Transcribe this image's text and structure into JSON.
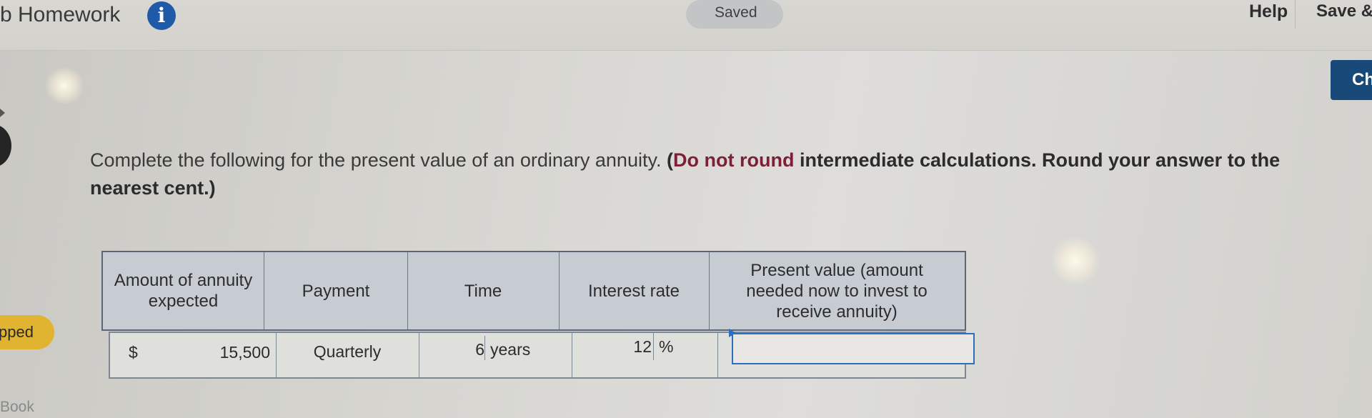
{
  "header": {
    "title": "b Homework",
    "info_glyph": "i",
    "saved_label": "Saved",
    "help_label": "Help",
    "save_exit_label": "Save &"
  },
  "check_button_label": "Ch",
  "sidebar": {
    "dropped_label": "pped",
    "ebook_label": "Book"
  },
  "question": {
    "text": "Complete the following for the present value of an ordinary annuity.",
    "instruction_open": "(",
    "instruction_do_not_round": "Do not round",
    "instruction_rest": "intermediate calculations. Round your answer to the nearest cent.)"
  },
  "table": {
    "headers": [
      "Amount of annuity expected",
      "Payment",
      "Time",
      "Interest rate",
      "Present value (amount needed now to invest to receive annuity)"
    ],
    "row": {
      "currency_symbol": "$",
      "amount": "15,500",
      "payment": "Quarterly",
      "time_value": "6",
      "time_unit": "years",
      "rate_value": "12",
      "rate_unit": "%",
      "present_value": ""
    }
  },
  "colors": {
    "info_icon": "#1e5aa8",
    "check_button": "#174a78",
    "dropped_tab": "#e0b430",
    "instruction_red": "#7d1f35",
    "answer_border": "#2c6fc0"
  }
}
